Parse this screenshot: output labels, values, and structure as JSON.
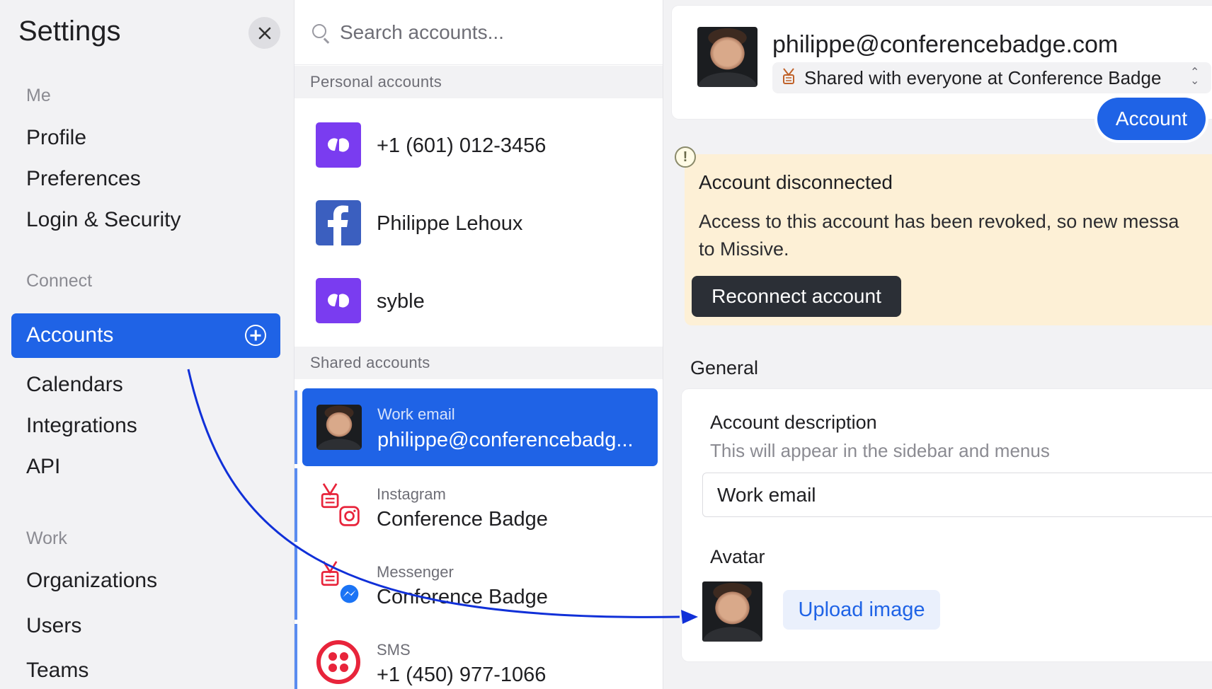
{
  "sidebar": {
    "title": "Settings",
    "sections": [
      {
        "label": "Me",
        "items": [
          "Profile",
          "Preferences",
          "Login & Security"
        ]
      },
      {
        "label": "Connect",
        "items": [
          "Accounts",
          "Calendars",
          "Integrations",
          "API"
        ]
      },
      {
        "label": "Work",
        "items": [
          "Organizations",
          "Users",
          "Teams"
        ]
      }
    ],
    "active_item": "Accounts"
  },
  "accounts_list": {
    "search_placeholder": "Search accounts...",
    "personal_header": "Personal accounts",
    "personal": [
      {
        "name": "+1 (601) 012-3456",
        "icon": "missive-icon"
      },
      {
        "name": "Philippe Lehoux",
        "icon": "facebook-icon"
      },
      {
        "name": "syble",
        "icon": "missive-icon"
      }
    ],
    "shared_header": "Shared accounts",
    "shared": [
      {
        "type": "Work email",
        "name": "philippe@conferencebadg...",
        "icon": "avatar"
      },
      {
        "type": "Instagram",
        "name": "Conference Badge",
        "icon": "instagram-badge-icon"
      },
      {
        "type": "Messenger",
        "name": "Conference Badge",
        "icon": "messenger-badge-icon"
      },
      {
        "type": "SMS",
        "name": "+1 (450) 977-1066",
        "icon": "twilio-icon"
      }
    ]
  },
  "detail": {
    "email": "philippe@conferencebadge.com",
    "sharing": "Shared with everyone at Conference Badge",
    "account_button": "Account",
    "alert": {
      "title": "Account disconnected",
      "body": "Access to this account has been revoked, so new messa\nto Missive.",
      "button": "Reconnect account"
    },
    "general_header": "General",
    "description_label": "Account description",
    "description_hint": "This will appear in the sidebar and menus",
    "description_value": "Work email",
    "avatar_label": "Avatar",
    "upload_button": "Upload image"
  },
  "colors": {
    "accent": "#1f63e6",
    "alert_bg": "#fdf0d6",
    "sidebar_bg": "#f2f2f4",
    "missive_purple": "#7a3cf0",
    "facebook_blue": "#3b5fbf",
    "twilio_red": "#e8243b"
  }
}
